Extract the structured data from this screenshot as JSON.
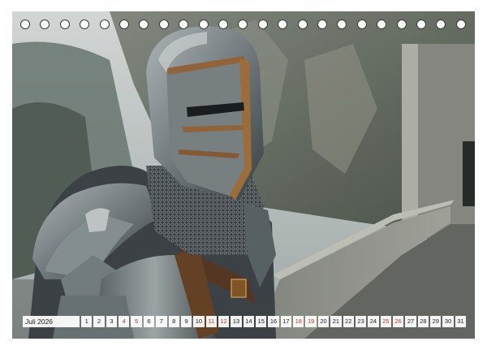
{
  "calendar": {
    "month_label": "Juli 2026",
    "days": [
      {
        "n": "1",
        "weekend": false
      },
      {
        "n": "2",
        "weekend": false
      },
      {
        "n": "3",
        "weekend": false
      },
      {
        "n": "4",
        "weekend": true
      },
      {
        "n": "5",
        "weekend": true
      },
      {
        "n": "6",
        "weekend": false
      },
      {
        "n": "7",
        "weekend": false
      },
      {
        "n": "8",
        "weekend": false
      },
      {
        "n": "9",
        "weekend": false
      },
      {
        "n": "10",
        "weekend": false
      },
      {
        "n": "11",
        "weekend": true
      },
      {
        "n": "12",
        "weekend": true
      },
      {
        "n": "13",
        "weekend": false
      },
      {
        "n": "14",
        "weekend": false
      },
      {
        "n": "15",
        "weekend": false
      },
      {
        "n": "16",
        "weekend": false
      },
      {
        "n": "17",
        "weekend": false
      },
      {
        "n": "18",
        "weekend": true
      },
      {
        "n": "19",
        "weekend": true
      },
      {
        "n": "20",
        "weekend": false
      },
      {
        "n": "21",
        "weekend": false
      },
      {
        "n": "22",
        "weekend": false
      },
      {
        "n": "23",
        "weekend": false
      },
      {
        "n": "24",
        "weekend": false
      },
      {
        "n": "25",
        "weekend": true
      },
      {
        "n": "26",
        "weekend": true
      },
      {
        "n": "27",
        "weekend": false
      },
      {
        "n": "28",
        "weekend": false
      },
      {
        "n": "29",
        "weekend": false
      },
      {
        "n": "30",
        "weekend": false
      },
      {
        "n": "31",
        "weekend": false
      }
    ]
  },
  "photo": {
    "subject": "knight-in-armor-icon"
  },
  "colors": {
    "weekend": "#c0392b",
    "text": "#222222"
  }
}
